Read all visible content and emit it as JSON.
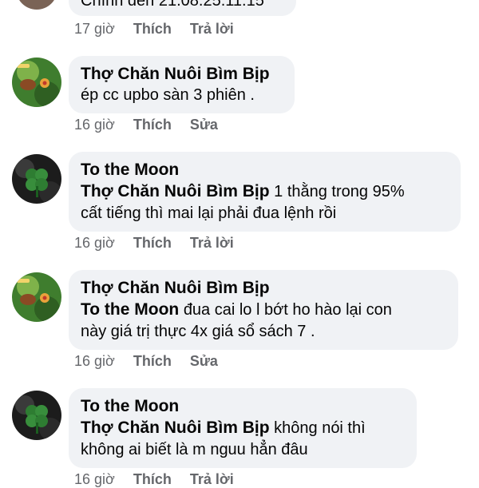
{
  "comments": [
    {
      "author": "",
      "mention": "",
      "text": "Chính đến 21.08.25.11.15",
      "time": "17 giờ",
      "actions": [
        "Thích",
        "Trả lời"
      ]
    },
    {
      "author": "Thợ Chăn Nuôi Bìm Bịp",
      "mention": "",
      "text": "ép cc upbo sàn 3 phiên .",
      "time": "16 giờ",
      "actions": [
        "Thích",
        "Sửa"
      ]
    },
    {
      "author": "To the Moon",
      "mention": "Thợ Chăn Nuôi Bìm Bịp",
      "text_line1": "1 thằng trong 95%",
      "text_line2": "cất tiếng thì mai lại phải đua lệnh rồi",
      "time": "16 giờ",
      "actions": [
        "Thích",
        "Trả lời"
      ]
    },
    {
      "author": "Thợ Chăn Nuôi Bìm Bịp",
      "mention": "To the Moon",
      "text_line1": "đua cai lo l bớt ho hào lại con",
      "text_line2": "này giá trị thực 4x giá sổ sách 7 .",
      "time": "16 giờ",
      "actions": [
        "Thích",
        "Sửa"
      ]
    },
    {
      "author": "To the Moon",
      "mention": "Thợ Chăn Nuôi Bìm Bịp",
      "text_line1": "không nói thì",
      "text_line2": "không ai biết là m nguu hẳn đâu",
      "time": "16 giờ",
      "actions": [
        "Thích",
        "Trả lời"
      ]
    }
  ],
  "colors": {
    "bubble": "#f0f2f5",
    "meta_text": "#65676b",
    "text": "#050505"
  },
  "icons": {
    "avatar_bimbip": "bird-garden-avatar-icon",
    "avatar_moon": "four-leaf-clover-avatar-icon"
  }
}
